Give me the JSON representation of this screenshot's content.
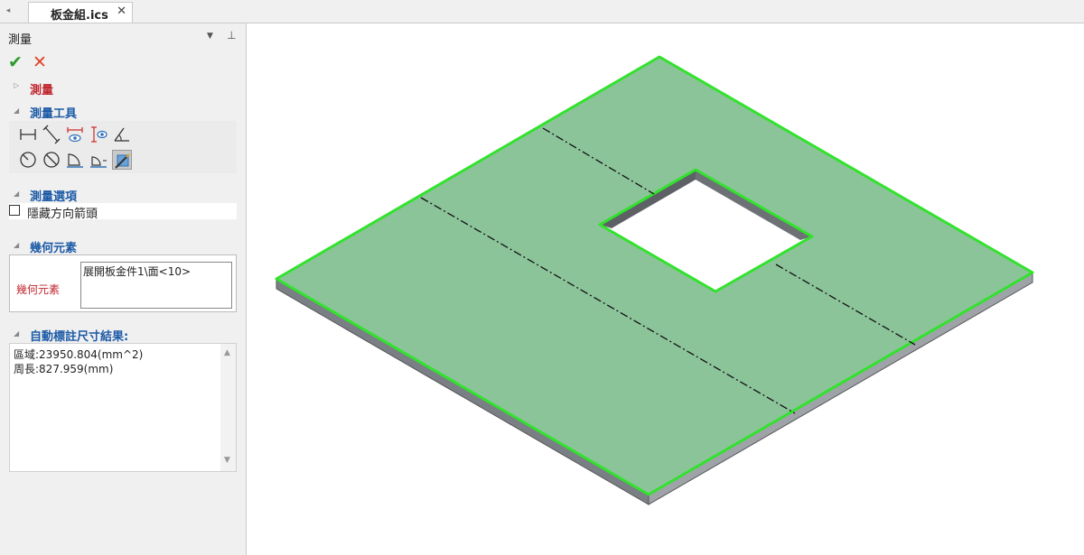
{
  "document_tab": {
    "nav_glyph": "◂",
    "title": "板金組.ics",
    "close_glyph": "✕"
  },
  "panel": {
    "title": "測量",
    "menu_glyph": "▼",
    "pin_glyph": "⊥",
    "ok_glyph": "✔",
    "cancel_glyph": "✕",
    "expanded_glyph": "◢",
    "collapsed_glyph": "▷",
    "sections": {
      "measure": "測量",
      "tools": "測量工具",
      "options": "測量選項",
      "geometry": "幾何元素",
      "results": "自動標註尺寸結果:"
    },
    "tools_row1": [
      "dimension-horizontal-icon",
      "dimension-aligned-icon",
      "dimension-view-horizontal-icon",
      "dimension-view-vertical-icon",
      "angle-icon"
    ],
    "tools_row2": [
      "circle-radius-icon",
      "circle-diameter-icon",
      "arc-length-icon",
      "arc-length-alt-icon",
      "area-measure-icon"
    ],
    "active_tool": "area-measure-icon",
    "hide_arrow_label": "隱藏方向箭頭",
    "hide_arrow_checked": false,
    "geometry_label": "幾何元素",
    "geometry_item": "展開板金件1\\面<10>",
    "result_area": "區域:23950.804(mm^2)",
    "result_perimeter": "周長:827.959(mm)",
    "scroll_up_glyph": "▲",
    "scroll_down_glyph": "▼"
  },
  "viewport": {
    "plate_fill": "#8cc49a",
    "edge_highlight": "#32e22d",
    "side_color": "#7a7f85",
    "background": "#ffffff"
  }
}
